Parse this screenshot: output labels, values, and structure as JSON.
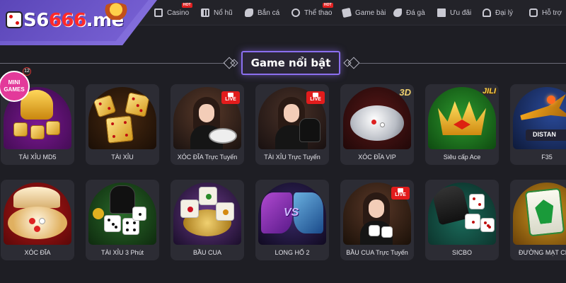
{
  "logo": {
    "part1": "S",
    "part2": "6",
    "part3": "666",
    "part4": ".me"
  },
  "nav": [
    {
      "label": "Casino",
      "icon": "casino-icon",
      "hot": true
    },
    {
      "label": "Nổ hũ",
      "icon": "slot-icon",
      "hot": false
    },
    {
      "label": "Bắn cá",
      "icon": "fish-icon",
      "hot": false
    },
    {
      "label": "Thể thao",
      "icon": "sports-icon",
      "hot": true
    },
    {
      "label": "Game bài",
      "icon": "cards-icon",
      "hot": false
    },
    {
      "label": "Đá gà",
      "icon": "rooster-icon",
      "hot": false
    },
    {
      "label": "Ưu đãi",
      "icon": "gift-icon",
      "hot": false
    },
    {
      "label": "Đại lý",
      "icon": "agent-icon",
      "hot": false
    },
    {
      "label": "Hỗ trợ",
      "icon": "support-icon",
      "hot": false
    }
  ],
  "hot_label": "HOT",
  "section": {
    "title": "Game nổi bật"
  },
  "games_row1": [
    {
      "label": "TÀI XỈU MD5",
      "art": "mini-games"
    },
    {
      "label": "TÀI XỈU",
      "art": "gold-dice"
    },
    {
      "label": "XÓC ĐĨA Trực Tuyến",
      "art": "live-dealer"
    },
    {
      "label": "TÀI XỈU Trực Tuyến",
      "art": "live-dealer"
    },
    {
      "label": "XÓC ĐĨA VIP",
      "art": "vip-bowl"
    },
    {
      "label": "Siêu cấp Ace",
      "art": "jili-crown"
    },
    {
      "label": "F35",
      "art": "jet"
    }
  ],
  "games_row2": [
    {
      "label": "XÓC ĐĨA",
      "art": "red-plate"
    },
    {
      "label": "TÀI XỈU 3 Phút",
      "art": "black-cup"
    },
    {
      "label": "BẦU CUA",
      "art": "bau-cua"
    },
    {
      "label": "LONG HỔ 2",
      "art": "dragon-tiger"
    },
    {
      "label": "BẦU CUA Trực Tuyến",
      "art": "live-dealer"
    },
    {
      "label": "SICBO",
      "art": "sicbo"
    },
    {
      "label": "ĐƯỜNG MẠT CHƯ",
      "art": "mahjong"
    }
  ],
  "badges": {
    "live": "LIVE",
    "three_d": "3D",
    "jili": "JILI",
    "mini_games": "MINI GAMES",
    "mini_count": "12",
    "distan": "DISTAN",
    "vs": "VS"
  },
  "colors": {
    "accent": "#8b6ff0",
    "background": "#1e1e24",
    "card": "#2c2c34",
    "hot": "#e02020"
  }
}
